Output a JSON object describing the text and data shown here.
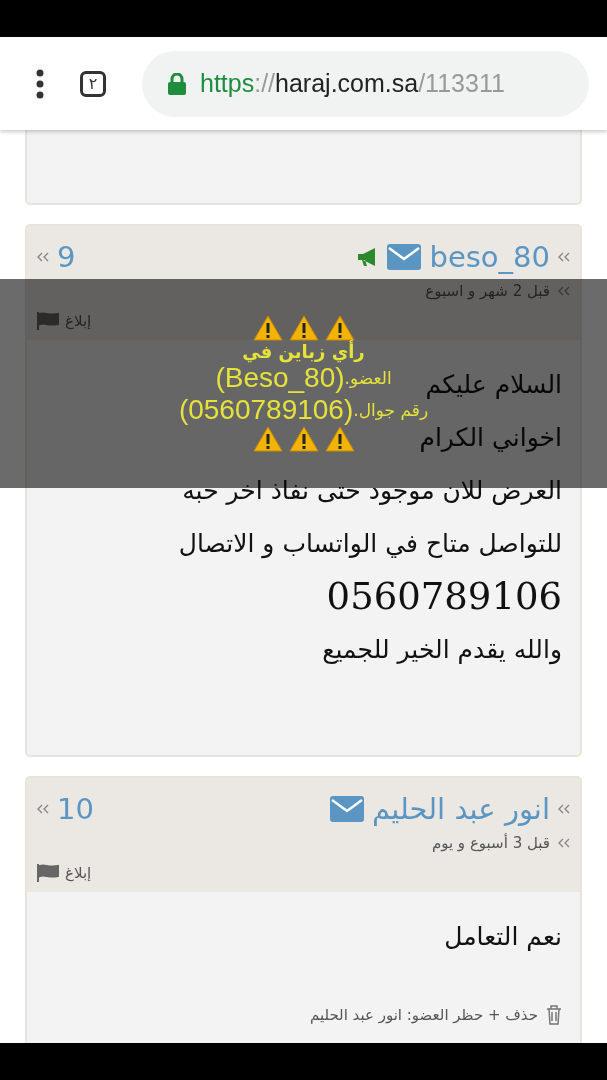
{
  "toolbar": {
    "tab_count": "٢",
    "url": {
      "scheme": "https",
      "separator": "://",
      "host": "haraj.com.sa",
      "path": "/113311"
    }
  },
  "comments": [
    {
      "number": "9",
      "author": "beso_80",
      "promoted": true,
      "time": "قبل 2 شهر و اسبوع",
      "report": "إبلاغ",
      "lines": [
        {
          "kind": "text",
          "text": "السلام عليكم"
        },
        {
          "kind": "text",
          "text": "اخواني الكرام"
        },
        {
          "kind": "text",
          "text": "العرض للان موجود حتى نفاذ اخر حبه"
        },
        {
          "kind": "text",
          "text": "للتواصل متاح في الواتساب و الاتصال"
        },
        {
          "kind": "phone",
          "text": "0560789106"
        },
        {
          "kind": "text",
          "text": "والله يقدم الخير للجميع"
        }
      ]
    },
    {
      "number": "10",
      "author": "انور عبد الحليم",
      "promoted": false,
      "time": "قبل 3 أسبوع و يوم",
      "report": "إبلاغ",
      "lines": [
        {
          "kind": "text",
          "text": "نعم التعامل"
        }
      ],
      "moderation": "حذف + حظر العضو: انور عبد الحليم"
    }
  ],
  "overlay": {
    "heading": "رأي زباين في",
    "rows": [
      {
        "label": "العضو.",
        "value": "(Beso_80)"
      },
      {
        "label": "رقم جوال.",
        "value": "(0560789106)"
      }
    ]
  }
}
